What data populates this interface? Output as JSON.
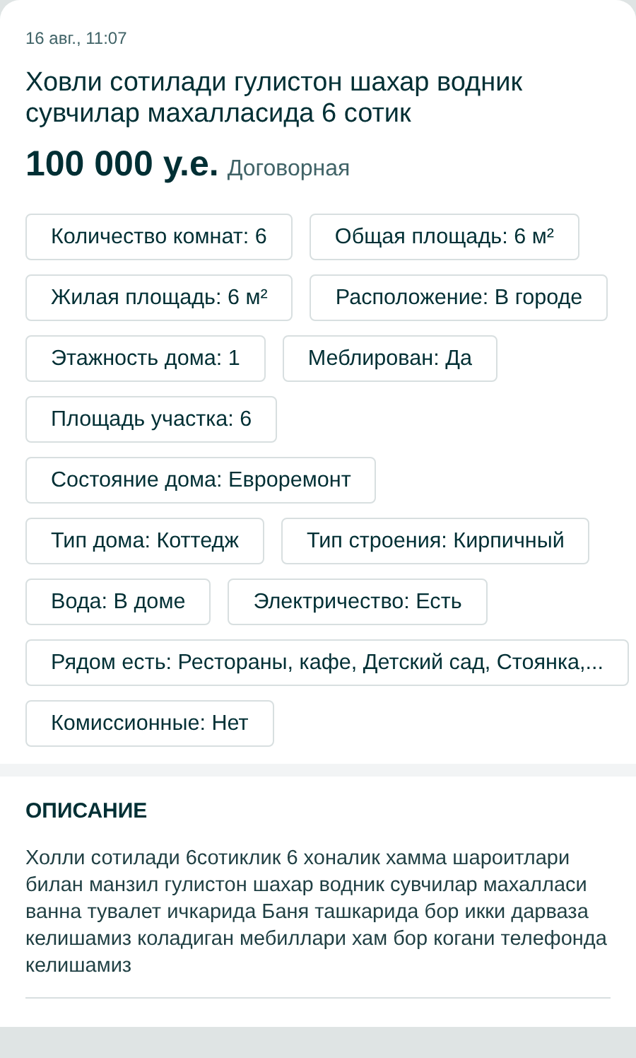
{
  "date": "16 авг., 11:07",
  "title": "Ховли сотилади гулистон шахар водник сувчилар махалласида 6 сотик",
  "price": "100 000 у.е.",
  "price_note": "Договорная",
  "params": [
    "Количество комнат: 6",
    "Общая площадь: 6 м²",
    "Жилая площадь: 6 м²",
    "Расположение: В городе",
    "Этажность дома: 1",
    "Меблирован: Да",
    "Площадь участка: 6",
    "Состояние дома: Евроремонт",
    "Тип дома: Коттедж",
    "Тип строения: Кирпичный",
    "Вода: В доме",
    "Электричество: Есть",
    "Рядом есть: Рестораны, кафе, Детский сад, Стоянка,...",
    "Комиссионные: Нет"
  ],
  "description": {
    "heading": "ОПИСАНИЕ",
    "text": "Холли сотилади 6сотиклик 6 хоналик хамма шароитлари билан манзил гулистон шахар водник сувчилар махалласи ванна тувалет ичкарида Баня ташкарида бор икки дарваза келишамиз коладиган мебиллари хам бор когани телефонда келишамиз"
  }
}
